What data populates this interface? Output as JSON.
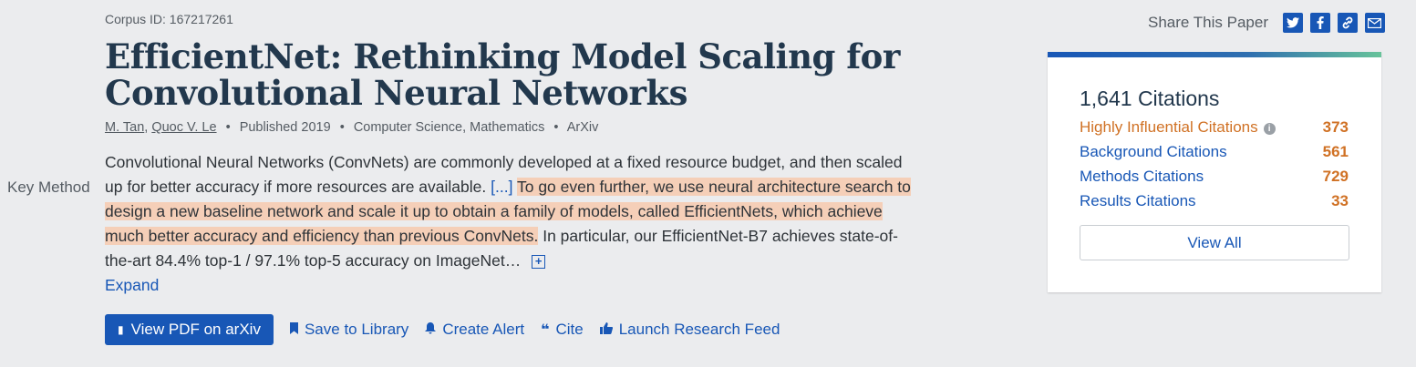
{
  "paper": {
    "corpus_id": "Corpus ID: 167217261",
    "title": "EfficientNet: Rethinking Model Scaling for Convolutional Neural Networks",
    "authors": [
      "M. Tan",
      "Quoc V. Le"
    ],
    "published": "Published 2019",
    "fields": "Computer Science, Mathematics",
    "venue": "ArXiv"
  },
  "abstract": {
    "key_label": "Key Method",
    "intro": "Convolutional Neural Networks (ConvNets) are commonly developed at a fixed resource budget, and then scaled up for better accuracy if more resources are available.",
    "ellipsis": "[...]",
    "highlight": "To go even further, we use neural architecture search to design a new baseline network and scale it up to obtain a family of models, called EfficientNets, which achieve much better accuracy and efficiency than previous ConvNets.",
    "tail": "In particular, our EfficientNet-B7 achieves state-of-the-art 84.4% top-1 / 97.1% top-5 accuracy on ImageNet…",
    "expand_label": "Expand"
  },
  "actions": {
    "pdf_label": "View PDF on arXiv",
    "save_label": "Save to Library",
    "alert_label": "Create Alert",
    "cite_label": "Cite",
    "feed_label": "Launch Research Feed"
  },
  "share": {
    "label": "Share This Paper",
    "icons": [
      "twitter-icon",
      "facebook-icon",
      "link-icon",
      "email-icon"
    ]
  },
  "citations": {
    "heading": "1,641 Citations",
    "rows": [
      {
        "label": "Highly Influential Citations",
        "count": "373"
      },
      {
        "label": "Background Citations",
        "count": "561"
      },
      {
        "label": "Methods Citations",
        "count": "729"
      },
      {
        "label": "Results Citations",
        "count": "33"
      }
    ],
    "view_all_label": "View All"
  },
  "colors": {
    "accent": "#1857b6",
    "highlight": "#f5cfb8",
    "citation_count": "#d07124",
    "title": "#22384d",
    "background": "#ebecee"
  }
}
